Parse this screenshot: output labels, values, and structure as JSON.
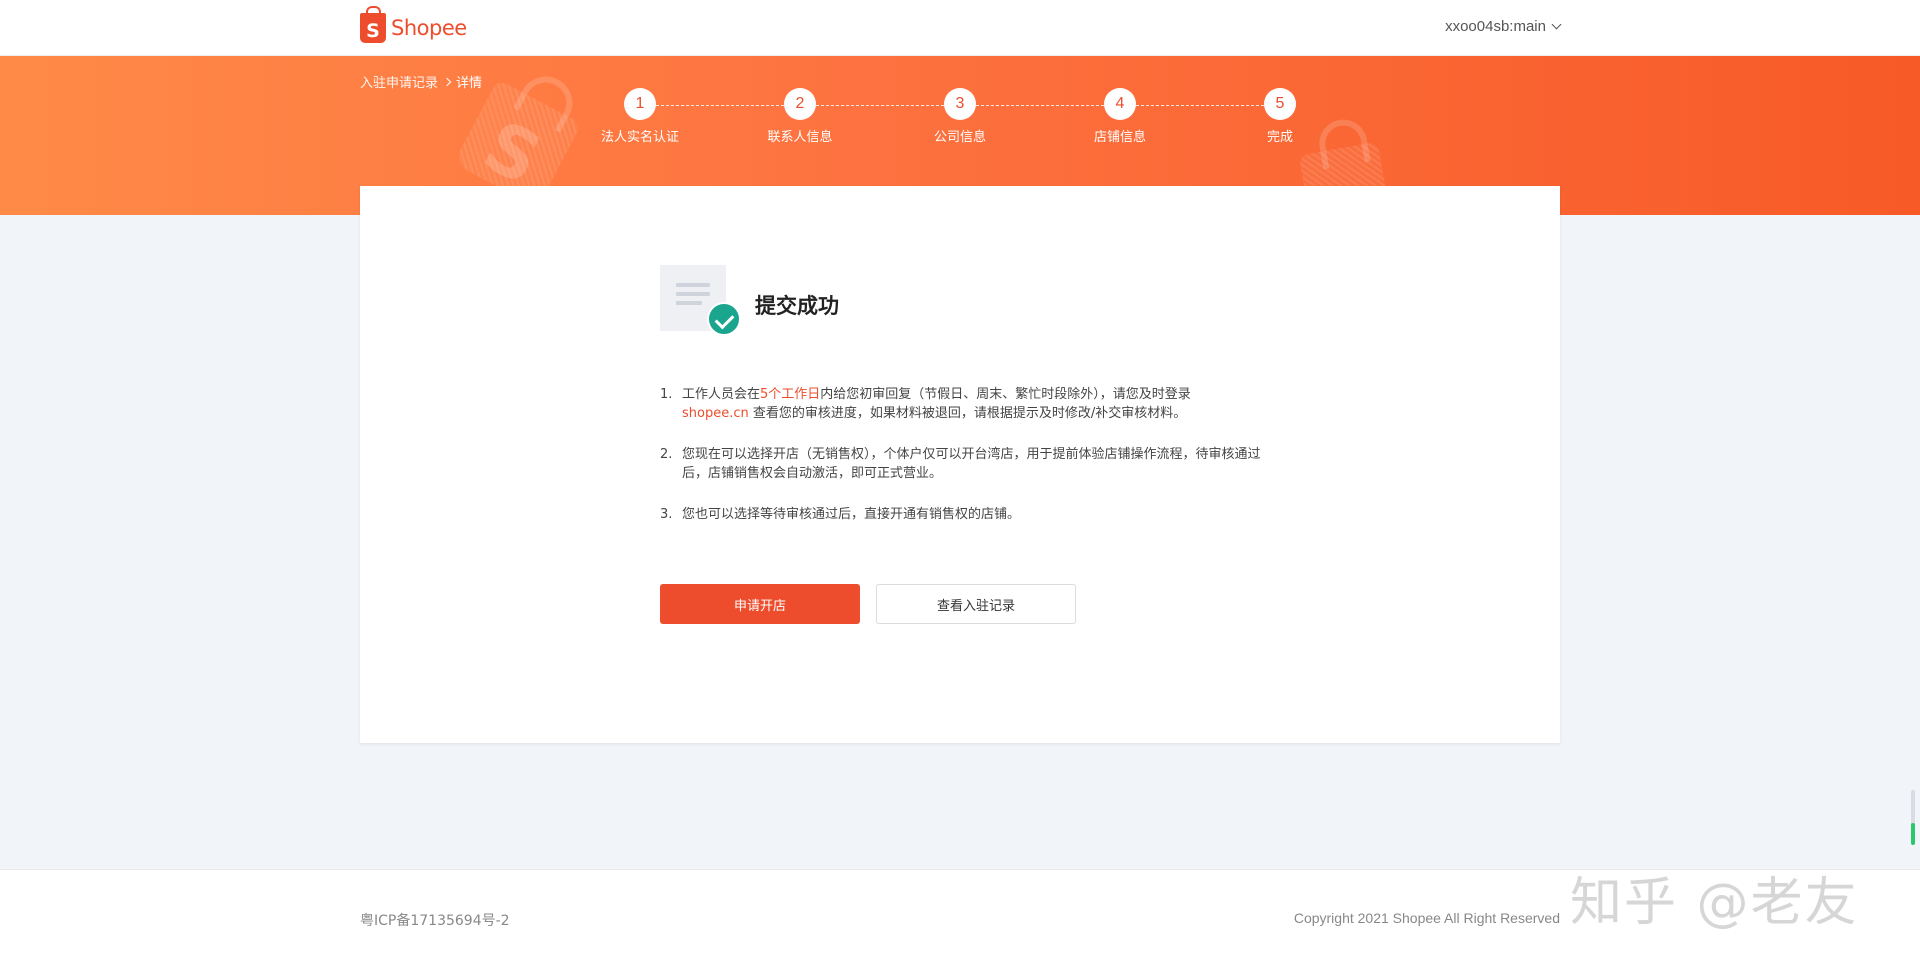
{
  "header": {
    "logo_text": "Shopee",
    "logo_bag_letter": "S",
    "username": "xxoo04sb:main"
  },
  "breadcrumb": {
    "parent": "入驻申请记录",
    "current": "详情"
  },
  "steps": [
    {
      "number": "1",
      "label": "法人实名认证"
    },
    {
      "number": "2",
      "label": "联系人信息"
    },
    {
      "number": "3",
      "label": "公司信息"
    },
    {
      "number": "4",
      "label": "店铺信息"
    },
    {
      "number": "5",
      "label": "完成"
    }
  ],
  "main": {
    "title": "提交成功",
    "notes": [
      {
        "num": "1.",
        "part1": "工作人员会在",
        "highlight": "5个工作日",
        "part2": "内给您初审回复（节假日、周末、繁忙时段除外），请您及时登录",
        "link": "shopee.cn",
        "part3": " 查看您的审核进度，如果材料被退回，请根据提示及时修改/补交审核材料。"
      },
      {
        "num": "2.",
        "text": "您现在可以选择开店（无销售权），个体户仅可以开台湾店，用于提前体验店铺操作流程，待审核通过后，店铺销售权会自动激活，即可正式营业。"
      },
      {
        "num": "3.",
        "text": "您也可以选择等待审核通过后，直接开通有销售权的店铺。"
      }
    ],
    "primary_button": "申请开店",
    "secondary_button": "查看入驻记录"
  },
  "footer": {
    "icp": "粤ICP备17135694号-2",
    "copyright": "Copyright 2021 Shopee All Right Reserved"
  },
  "watermark": "知乎 @老友",
  "colors": {
    "brand": "#ee4d2d",
    "success": "#1aa68e",
    "banner_start": "#ff8a47",
    "banner_end": "#f75a27"
  }
}
